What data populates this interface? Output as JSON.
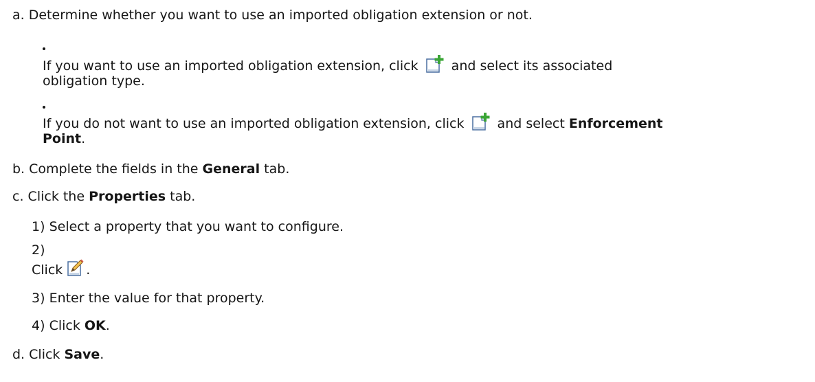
{
  "steps": {
    "a": {
      "marker": "a.",
      "text": "Determine whether you want to use an imported obligation extension or not.",
      "bullet1": {
        "pre": "If you want to use an imported obligation extension, click",
        "post": "and select its associated",
        "cont": "obligation type.",
        "icon": "new-document-plus-icon"
      },
      "bullet2": {
        "pre": "If you do not want to use an imported obligation extension, click",
        "mid": "and select",
        "bold1": "Enforcement",
        "bold2": "Point",
        "end": ".",
        "icon": "new-document-plus-icon"
      }
    },
    "b": {
      "marker": "b.",
      "pre": "Complete the fields in the",
      "bold": "General",
      "post": "tab."
    },
    "c": {
      "marker": "c.",
      "pre": "Click the",
      "bold": "Properties",
      "post": "tab.",
      "sub": [
        {
          "marker": "1)",
          "text": "Select a property that you want to configure."
        },
        {
          "marker": "2)",
          "pre": "Click",
          "end": ".",
          "icon": "edit-pencil-icon"
        },
        {
          "marker": "3)",
          "text": "Enter the value for that property."
        },
        {
          "marker": "4)",
          "pre": "Click",
          "bold": "OK",
          "end": "."
        }
      ]
    },
    "d": {
      "marker": "d.",
      "pre": "Click",
      "bold": "Save",
      "end": "."
    }
  }
}
